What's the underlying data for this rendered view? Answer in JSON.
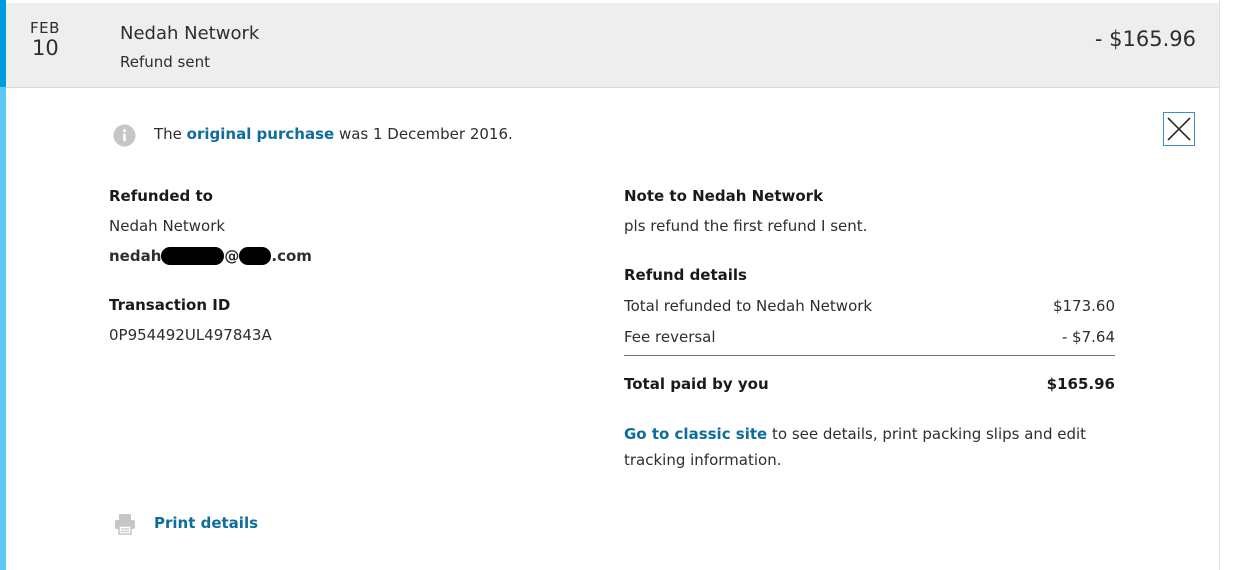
{
  "header": {
    "month": "FEB",
    "day": "10",
    "merchant": "Nedah Network",
    "status": "Refund sent",
    "amount": "- $165.96"
  },
  "info": {
    "prefix": "The ",
    "link": "original purchase",
    "suffix": " was 1 December 2016."
  },
  "refunded_to": {
    "label": "Refunded to",
    "name": "Nedah Network",
    "email_start": "nedah",
    "email_at": "@",
    "email_end": ".com"
  },
  "transaction": {
    "label": "Transaction ID",
    "id": "0P954492UL497843A"
  },
  "note": {
    "label": "Note to Nedah Network",
    "text": "pls refund the first refund I sent."
  },
  "refund_details": {
    "label": "Refund details",
    "rows": [
      {
        "label": "Total refunded to Nedah Network",
        "value": "$173.60"
      },
      {
        "label": "Fee reversal",
        "value": "- $7.64"
      }
    ],
    "total_label": "Total paid by you",
    "total_value": "$165.96"
  },
  "classic": {
    "link": "Go to classic site",
    "text": " to see details, print packing slips and edit tracking information."
  },
  "print": {
    "label": "Print details"
  },
  "colors": {
    "accent": "#009cde",
    "link": "#0f6c9e",
    "header_bg": "#eeeeee"
  },
  "icons": {
    "info": "info-icon",
    "close": "close-icon",
    "print": "printer-icon"
  }
}
